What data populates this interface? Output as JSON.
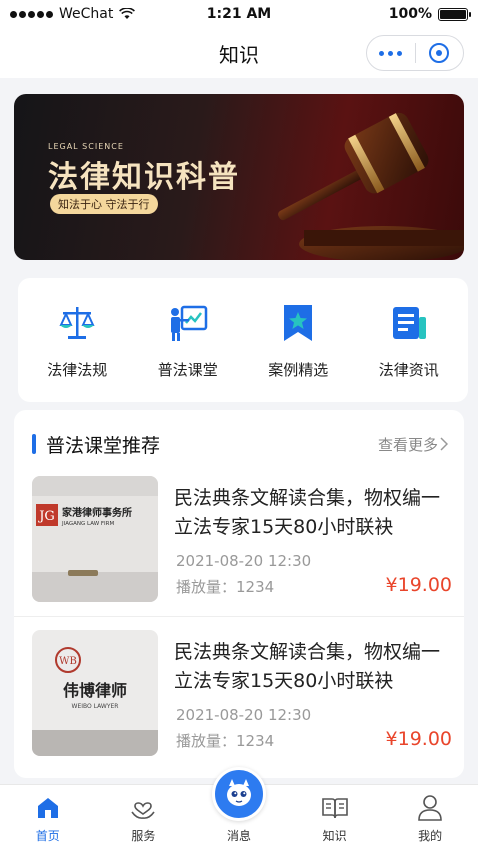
{
  "status_bar": {
    "carrier": "WeChat",
    "time": "1:21 AM",
    "battery": "100%"
  },
  "nav": {
    "title": "知识"
  },
  "banner": {
    "small_text": "LEGAL SCIENCE",
    "title": "法律知识科普",
    "tag": "知法于心 守法于行"
  },
  "categories": [
    {
      "label": "法律法规",
      "icon": "scales-icon"
    },
    {
      "label": "普法课堂",
      "icon": "classroom-icon"
    },
    {
      "label": "案例精选",
      "icon": "bookmark-star-icon"
    },
    {
      "label": "法律资讯",
      "icon": "news-icon"
    }
  ],
  "recommend": {
    "title": "普法课堂推荐",
    "more": "查看更多",
    "courses": [
      {
        "title": "民法典条文解读合集，物权编一立法专家15天80小时联袂",
        "date": "2021-08-20 12:30",
        "plays_label": "播放量：",
        "plays": "1234",
        "price": "¥19.00",
        "thumb_cn": "家港律师事务所",
        "thumb_en": "JIAGANG LAW FIRM"
      },
      {
        "title": "民法典条文解读合集，物权编一立法专家15天80小时联袂",
        "date": "2021-08-20 12:30",
        "plays_label": "播放量：",
        "plays": "1234",
        "price": "¥19.00",
        "thumb_cn": "伟博律师",
        "thumb_en": "WEIBO LAWYER"
      }
    ]
  },
  "tabs": [
    {
      "label": "首页",
      "icon": "home-icon",
      "active": true
    },
    {
      "label": "服务",
      "icon": "service-heart-icon",
      "active": false
    },
    {
      "label": "消息",
      "icon": "message-mascot-icon",
      "active": false
    },
    {
      "label": "知识",
      "icon": "book-icon",
      "active": false
    },
    {
      "label": "我的",
      "icon": "user-icon",
      "active": false
    }
  ],
  "colors": {
    "accent": "#1e6ee6",
    "price": "#e9452b",
    "background": "#f3f4f7"
  }
}
